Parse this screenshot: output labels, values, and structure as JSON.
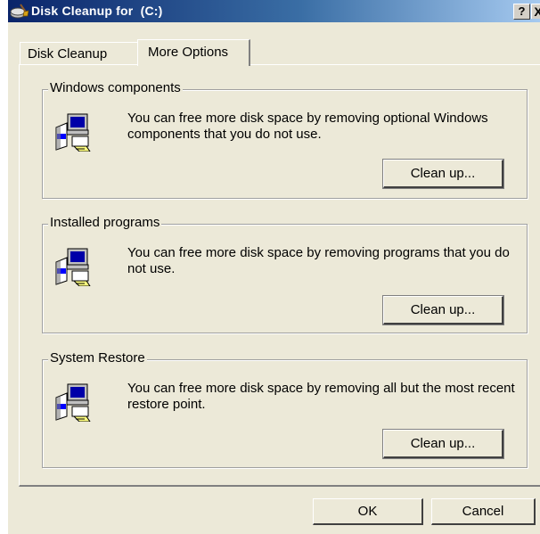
{
  "window": {
    "title": "Disk Cleanup for  (C:)",
    "help_label": "?",
    "close_label": "X",
    "app_icon": "disk-cleanup-icon"
  },
  "tabs": [
    {
      "label": "Disk Cleanup",
      "selected": false
    },
    {
      "label": "More Options",
      "selected": true
    }
  ],
  "groups": [
    {
      "title": "Windows components",
      "text": "You can free more disk space by removing optional Windows components that you do not use.",
      "button": "Clean up...",
      "icon": "computer-setup-icon"
    },
    {
      "title": "Installed programs",
      "text": "You can free more disk space by removing programs that you do not use.",
      "button": "Clean up...",
      "icon": "computer-setup-icon"
    },
    {
      "title": "System Restore",
      "text": "You can free more disk space by removing all but the most recent restore point.",
      "button": "Clean up...",
      "icon": "computer-setup-icon"
    }
  ],
  "footer": {
    "ok_label": "OK",
    "cancel_label": "Cancel"
  },
  "colors": {
    "face": "#ece9d8",
    "title_start": "#0a246a",
    "title_end": "#a6caf0",
    "shadow": "#808080"
  }
}
